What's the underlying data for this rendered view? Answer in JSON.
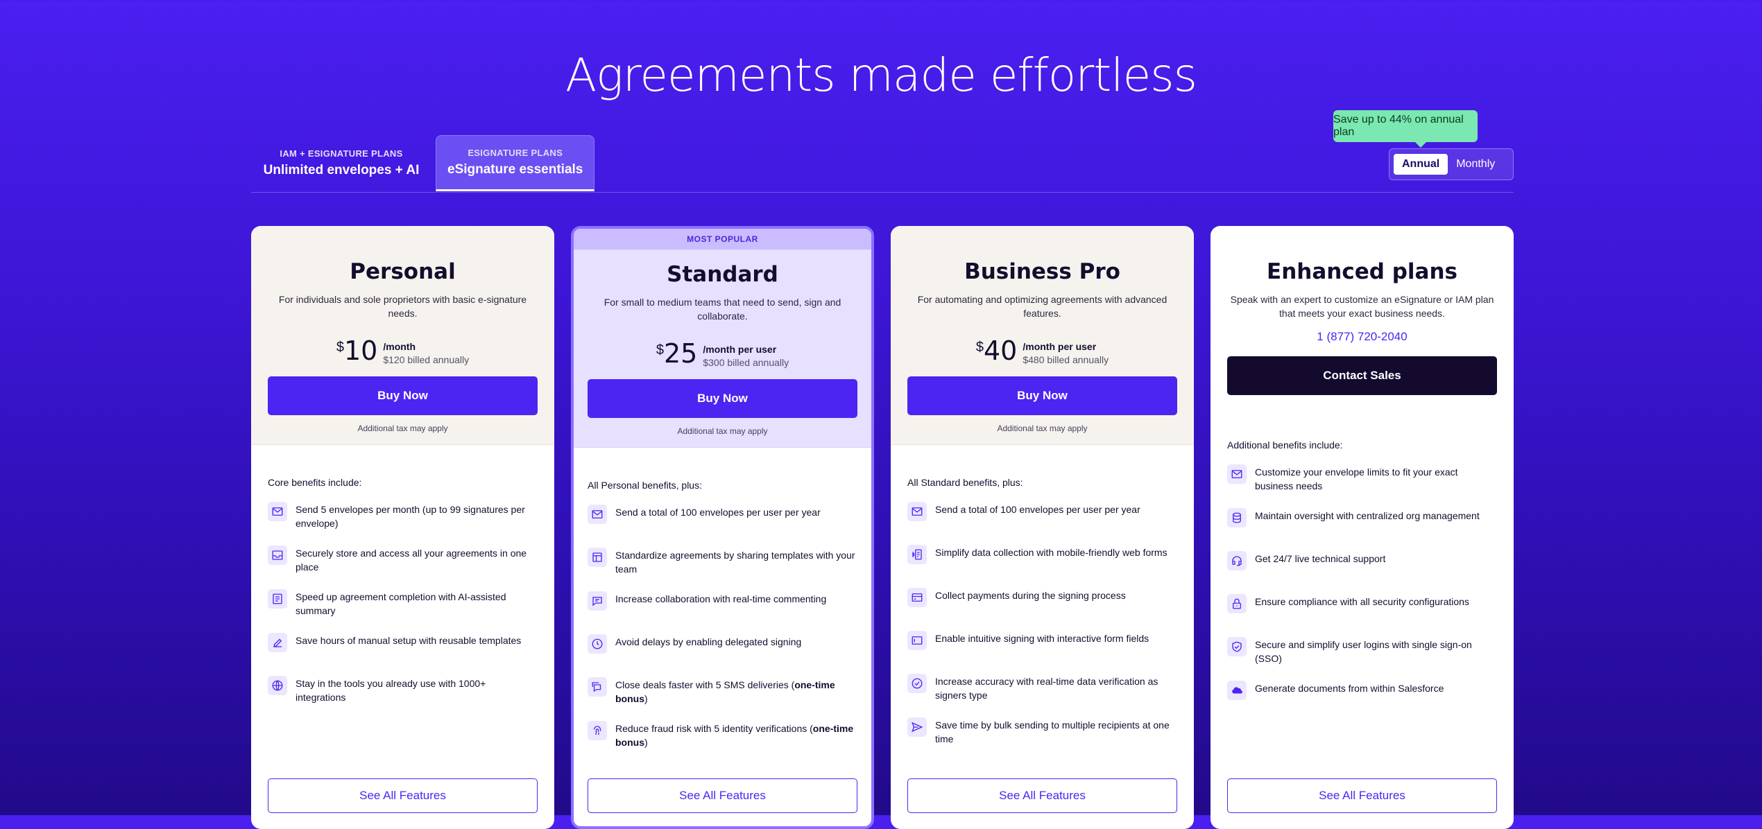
{
  "title": "Agreements made effortless",
  "tabs": [
    {
      "sub": "IAM + ESIGNATURE PLANS",
      "main": "Unlimited envelopes + AI"
    },
    {
      "sub": "ESIGNATURE PLANS",
      "main": "eSignature essentials"
    }
  ],
  "billing": {
    "badge": "Save up to 44% on annual plan",
    "annual": "Annual",
    "monthly": "Monthly"
  },
  "colors": {
    "accent": "#4c25f2",
    "badge": "#7ae8b0",
    "dark_button": "#130a2e"
  },
  "plans": [
    {
      "name": "Personal",
      "desc": "For individuals and sole proprietors with basic e-signature needs.",
      "currency": "$",
      "amount": "10",
      "per": "/month",
      "billed": "$120 billed annually",
      "cta": "Buy Now",
      "tax": "Additional tax may apply",
      "benefits_head": "Core benefits include:",
      "benefits": [
        {
          "icon": "envelope-icon",
          "text": "Send 5 envelopes per month (up to 99 signatures per envelope)"
        },
        {
          "icon": "inbox-icon",
          "text": "Securely store and access all your agreements in one place"
        },
        {
          "icon": "summary-icon",
          "text": "Speed up agreement completion with AI-assisted summary"
        },
        {
          "icon": "edit-template-icon",
          "text": "Save hours of manual setup with reusable templates"
        },
        {
          "icon": "globe-icon",
          "text": "Stay in the tools you already use with 1000+ integrations"
        }
      ],
      "see_all": "See All Features"
    },
    {
      "badge": "MOST POPULAR",
      "name": "Standard",
      "desc": "For small to medium teams that need to send, sign and collaborate.",
      "currency": "$",
      "amount": "25",
      "per": "/month per user",
      "billed": "$300 billed annually",
      "cta": "Buy Now",
      "tax": "Additional tax may apply",
      "benefits_head": "All Personal benefits, plus:",
      "benefits": [
        {
          "icon": "envelope-icon",
          "text": "Send a total of 100 envelopes per user per year"
        },
        {
          "icon": "template-icon",
          "text": "Standardize agreements by sharing templates with your team"
        },
        {
          "icon": "comment-icon",
          "text": "Increase collaboration with real-time commenting"
        },
        {
          "icon": "clock-icon",
          "text": "Avoid delays by enabling delegated signing"
        },
        {
          "icon": "sms-icon",
          "text_pre": "Close deals faster with 5 SMS deliveries (",
          "text_bold": "one-time bonus",
          "text_post": ")"
        },
        {
          "icon": "fingerprint-icon",
          "text_pre": "Reduce fraud risk with 5 identity verifications (",
          "text_bold": "one-time bonus",
          "text_post": ")"
        }
      ],
      "see_all": "See All Features"
    },
    {
      "name": "Business Pro",
      "desc": "For automating and optimizing agreements with advanced features.",
      "currency": "$",
      "amount": "40",
      "per": "/month per user",
      "billed": "$480 billed annually",
      "cta": "Buy Now",
      "tax": "Additional tax may apply",
      "benefits_head": "All Standard benefits, plus:",
      "benefits": [
        {
          "icon": "envelope-icon",
          "text": "Send a total of 100 envelopes per user per year"
        },
        {
          "icon": "web-form-icon",
          "text": "Simplify data collection with mobile-friendly web forms"
        },
        {
          "icon": "payment-card-icon",
          "text": "Collect payments during the signing process"
        },
        {
          "icon": "form-field-icon",
          "text": "Enable intuitive signing with interactive form fields"
        },
        {
          "icon": "check-circle-icon",
          "text": "Increase accuracy with real-time data verification as signers type"
        },
        {
          "icon": "send-icon",
          "text": "Save time by bulk sending to multiple recipients at one time"
        }
      ],
      "see_all": "See All Features"
    },
    {
      "name": "Enhanced plans",
      "desc": "Speak with an expert to customize an eSignature or IAM plan that meets your exact business needs.",
      "phone": "1 (877) 720-2040",
      "cta": "Contact Sales",
      "benefits_head": "Additional benefits include:",
      "benefits": [
        {
          "icon": "envelope-icon",
          "text": "Customize your envelope limits to fit your exact business needs"
        },
        {
          "icon": "database-icon",
          "text": "Maintain oversight with centralized org management"
        },
        {
          "icon": "headset-icon",
          "text": "Get 24/7 live technical support"
        },
        {
          "icon": "lock-icon",
          "text": "Ensure compliance with all security configurations"
        },
        {
          "icon": "shield-check-icon",
          "text": "Secure and simplify user logins with single sign-on (SSO)"
        },
        {
          "icon": "salesforce-cloud-icon",
          "text": "Generate documents from within Salesforce"
        }
      ],
      "see_all": "See All Features"
    }
  ]
}
